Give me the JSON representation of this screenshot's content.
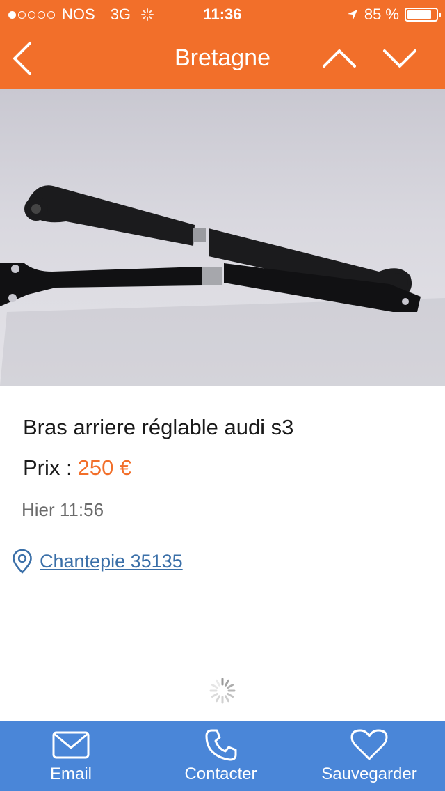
{
  "status_bar": {
    "carrier": "NOS",
    "network": "3G",
    "time": "11:36",
    "battery_text": "85 %",
    "battery_level": 0.85,
    "signal_bars_filled": 1,
    "signal_bars_total": 5
  },
  "nav": {
    "title": "Bretagne",
    "back_icon": "chevron-left-icon",
    "prev_icon": "chevron-up-icon",
    "next_icon": "chevron-down-icon"
  },
  "gallery": {
    "image_count": 3,
    "active_index": 0
  },
  "listing": {
    "title": "Bras arriere réglable audi s3",
    "price_label": "Prix :",
    "price_value": "250 €",
    "date": "Hier 11:56",
    "location": "Chantepie 35135"
  },
  "bottom_bar": {
    "email_label": "Email",
    "contact_label": "Contacter",
    "save_label": "Sauvegarder"
  },
  "colors": {
    "brand_orange": "#f26f2a",
    "bottom_blue": "#4a86d8",
    "link_blue": "#3a6fa8"
  }
}
